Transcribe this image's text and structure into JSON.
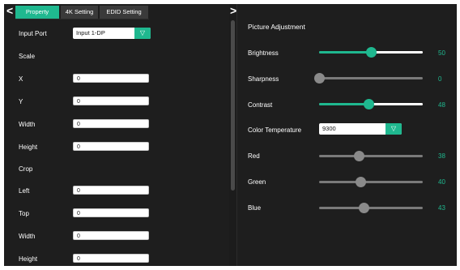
{
  "nav": {
    "prev": "<",
    "next": ">"
  },
  "tabs": [
    {
      "label": "Property",
      "active": true
    },
    {
      "label": "4K Setting",
      "active": false
    },
    {
      "label": "EDID Setting",
      "active": false
    }
  ],
  "left_panel": {
    "input_port_label": "Input Port",
    "input_port_value": "Input 1-DP",
    "scale_label": "Scale",
    "scale_fields": [
      {
        "label": "X",
        "value": "0"
      },
      {
        "label": "Y",
        "value": "0"
      },
      {
        "label": "Width",
        "value": "0"
      },
      {
        "label": "Height",
        "value": "0"
      }
    ],
    "crop_label": "Crop",
    "crop_fields": [
      {
        "label": "Left",
        "value": "0"
      },
      {
        "label": "Top",
        "value": "0"
      },
      {
        "label": "Width",
        "value": "0"
      },
      {
        "label": "Height",
        "value": "0"
      }
    ]
  },
  "picture": {
    "title": "Picture Adjustment",
    "sliders": [
      {
        "label": "Brightness",
        "value": "50",
        "level": 0.5,
        "style": "accent"
      },
      {
        "label": "Sharpness",
        "value": "0",
        "level": 0.0,
        "style": "grey"
      },
      {
        "label": "Contrast",
        "value": "48",
        "level": 0.48,
        "style": "accent"
      }
    ],
    "color_temperature_label": "Color Temperature",
    "color_temperature_value": "9300",
    "rgb_sliders": [
      {
        "label": "Red",
        "value": "38",
        "level": 0.38,
        "style": "grey"
      },
      {
        "label": "Green",
        "value": "40",
        "level": 0.4,
        "style": "grey"
      },
      {
        "label": "Blue",
        "value": "43",
        "level": 0.43,
        "style": "grey"
      }
    ]
  },
  "icons": {
    "dropdown": "chevron-down-icon"
  },
  "colors": {
    "accent": "#1fb88f",
    "panel": "#1e1e1e",
    "grey_knob": "#8a8a8a"
  }
}
